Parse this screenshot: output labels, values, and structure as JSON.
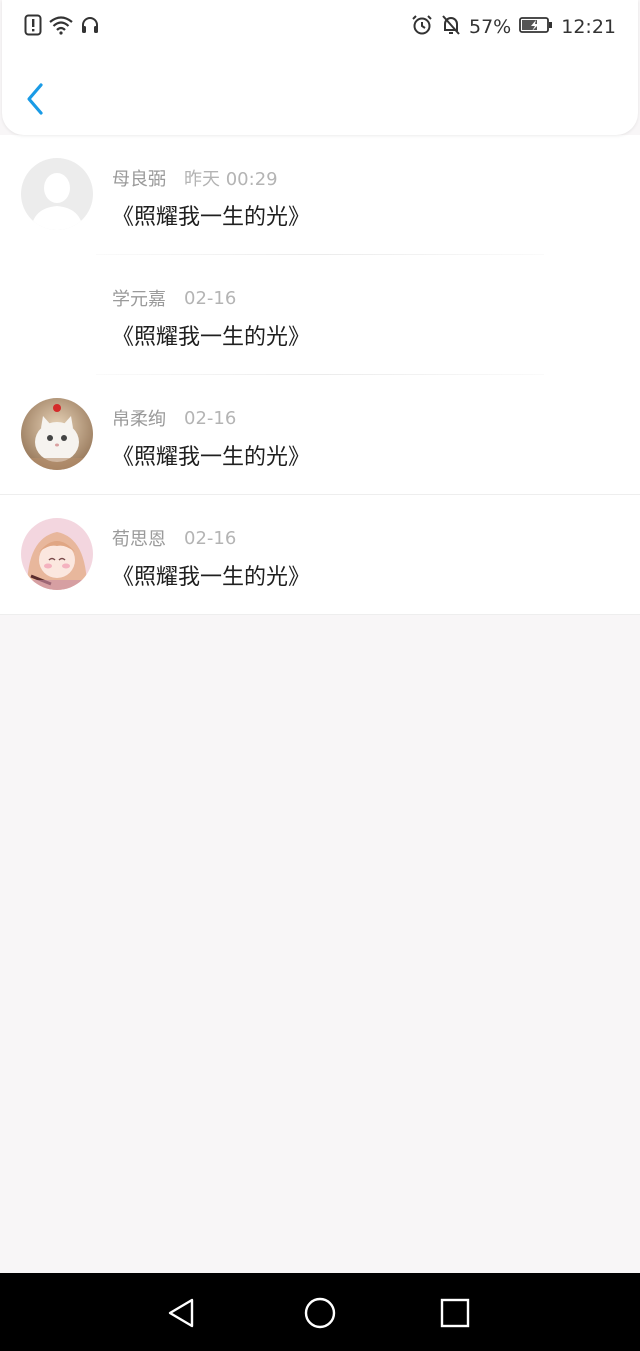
{
  "status_bar": {
    "battery_percent": "57%",
    "time": "12:21",
    "left_icons": [
      "warning-sim-icon",
      "wifi-icon",
      "headset-icon"
    ],
    "right_icons": [
      "alarm-icon",
      "bell-muted-icon",
      "battery-charging-icon"
    ]
  },
  "header": {
    "back_icon": "chevron-left-icon",
    "accent_color": "#1a9be6"
  },
  "comments": [
    {
      "name": "母良弼",
      "time": "昨天 00:29",
      "content": "《照耀我一生的光》",
      "avatar": "default-silhouette"
    },
    {
      "name": "学元嘉",
      "time": "02-16",
      "content": "《照耀我一生的光》",
      "avatar": "none"
    },
    {
      "name": "帛柔绚",
      "time": "02-16",
      "content": "《照耀我一生的光》",
      "avatar": "white-cat-photo"
    },
    {
      "name": "荀思恩",
      "time": "02-16",
      "content": "《照耀我一生的光》",
      "avatar": "anime-girl-illustration"
    }
  ],
  "nav_bar": {
    "icons": [
      "back-triangle-icon",
      "home-circle-icon",
      "recents-square-icon"
    ]
  }
}
